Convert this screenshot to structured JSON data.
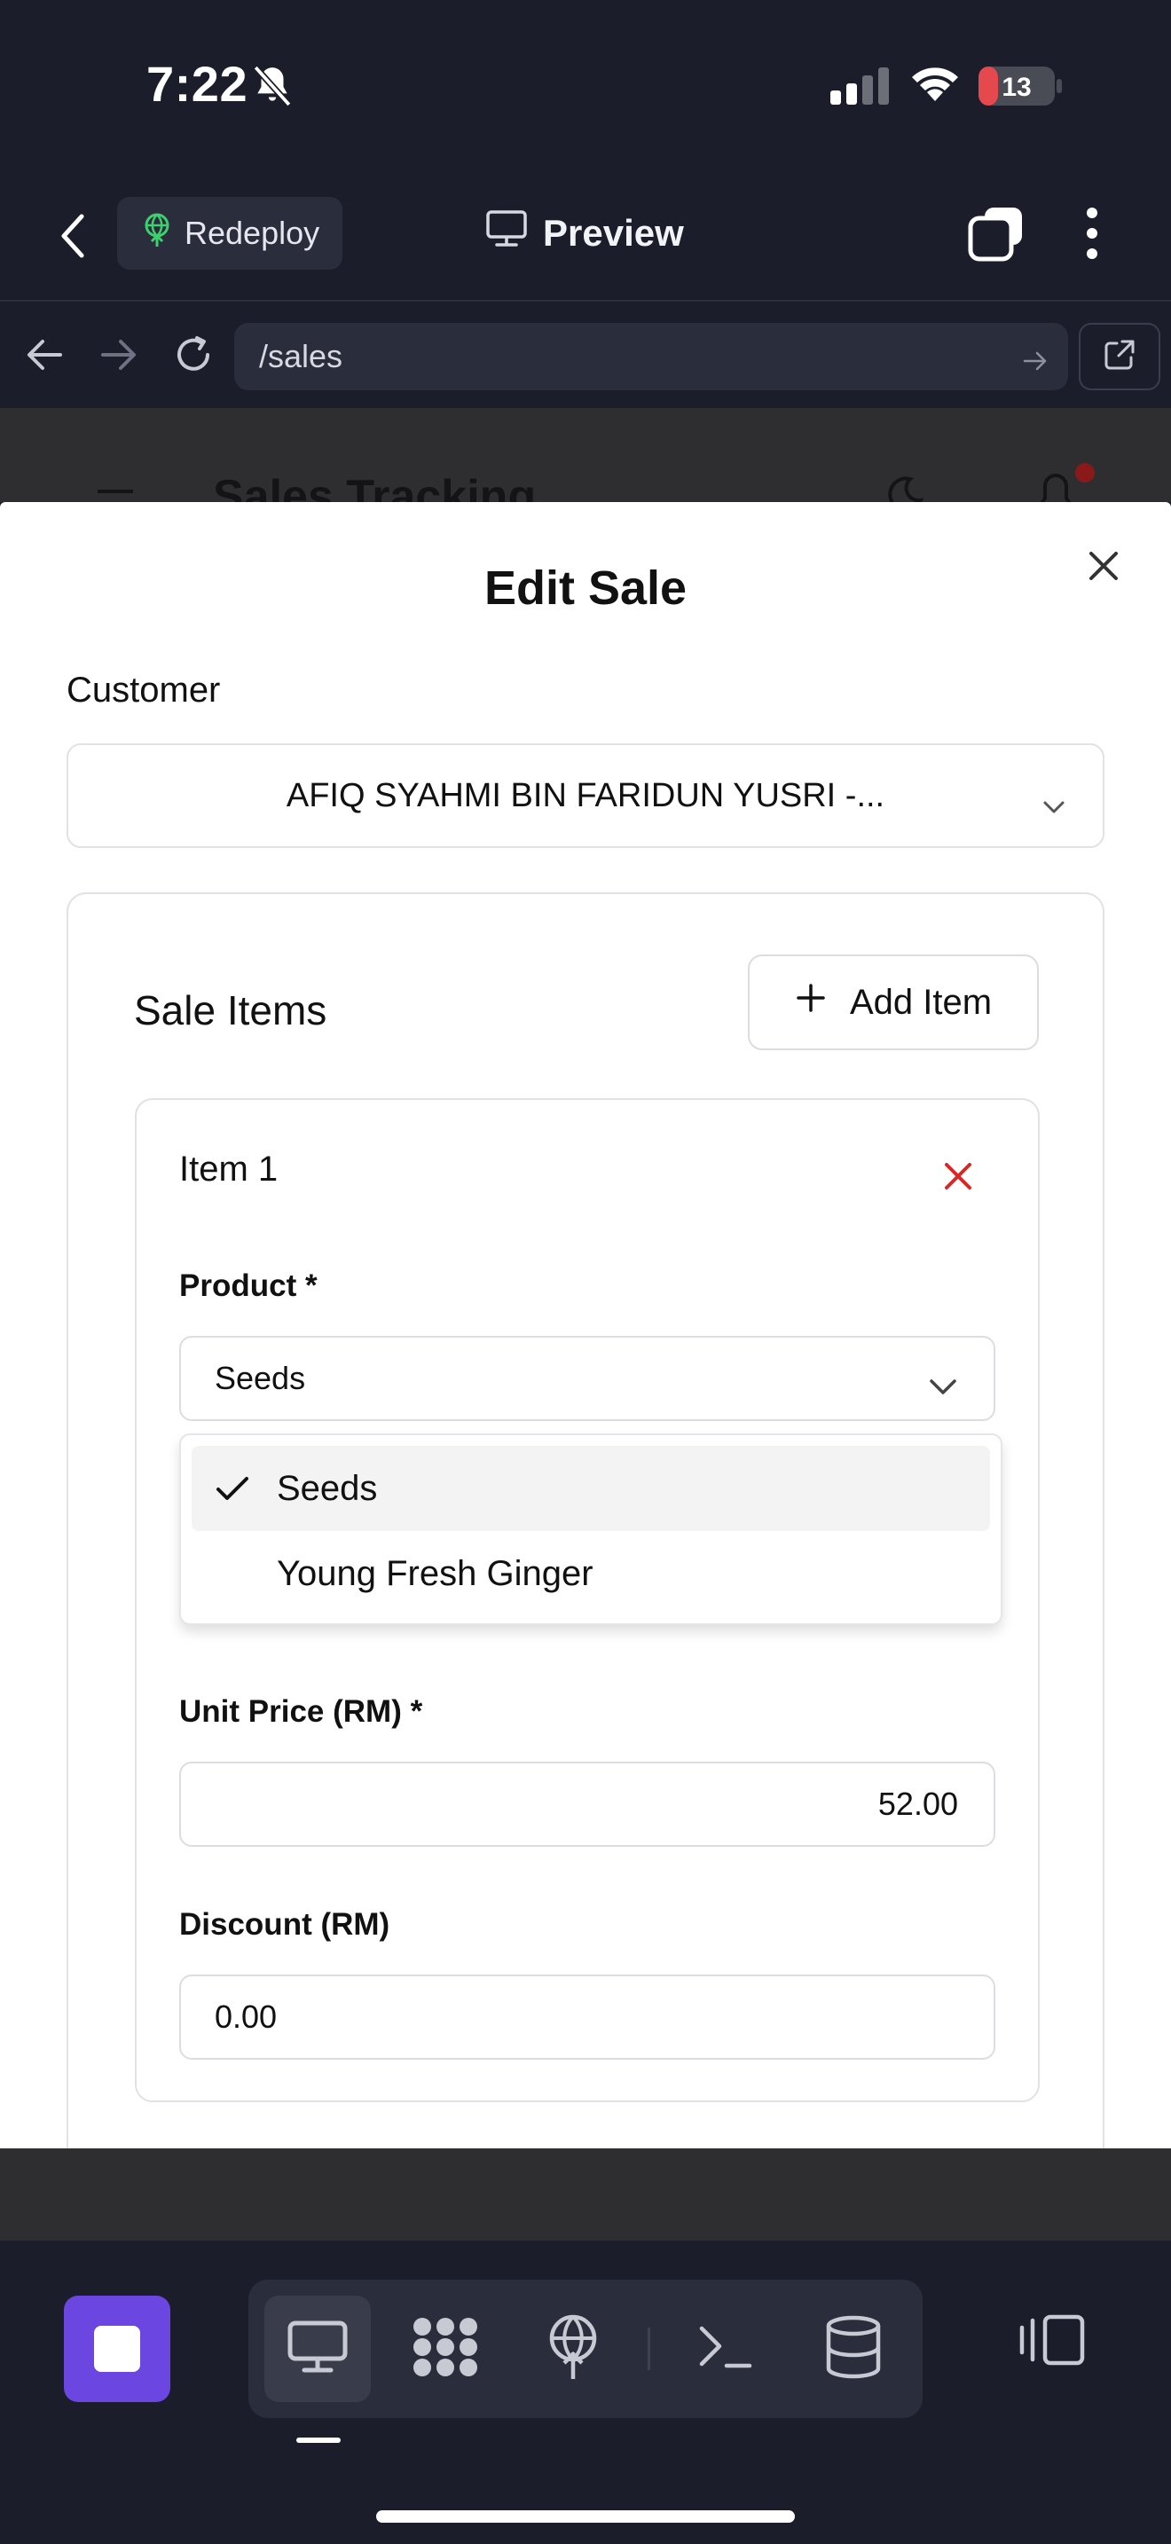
{
  "status_bar": {
    "time": "7:22",
    "battery_level": "13",
    "icons": [
      "bell-slash-icon",
      "cellular-signal-icon",
      "wifi-icon",
      "battery-icon"
    ]
  },
  "app_header": {
    "redeploy_label": "Redeploy",
    "preview_label": "Preview",
    "icons": [
      "chevron-left-icon",
      "globe-icon",
      "monitor-icon",
      "windows-icon",
      "more-vertical-icon"
    ]
  },
  "browser_bar": {
    "url": "/sales",
    "icons": [
      "arrow-left-icon",
      "arrow-right-icon",
      "reload-icon",
      "arrow-right-small-icon",
      "external-link-icon"
    ]
  },
  "background_page": {
    "title": "Sales Tracking"
  },
  "modal": {
    "title": "Edit Sale",
    "customer": {
      "label": "Customer",
      "value": "AFIQ SYAHMI BIN FARIDUN YUSRI -..."
    },
    "sale_items": {
      "title": "Sale Items",
      "add_item_label": "Add Item",
      "items": [
        {
          "title": "Item 1",
          "product_label": "Product *",
          "product_value": "Seeds",
          "product_options": [
            {
              "label": "Seeds",
              "selected": true
            },
            {
              "label": "Young Fresh Ginger",
              "selected": false
            }
          ],
          "unit_price_label": "Unit Price (RM) *",
          "unit_price_value": "52.00",
          "discount_label": "Discount (RM)",
          "discount_value": "0.00"
        }
      ]
    }
  },
  "bottom_toolbar": {
    "accent_color": "#6b46e0",
    "tools": [
      "monitor-icon",
      "apps-icon",
      "deploy-icon",
      "terminal-icon",
      "database-icon"
    ],
    "active_tool": "monitor-icon"
  },
  "colors": {
    "dark_background": "#1b1d2b",
    "remove_red": "#dc2626",
    "battery_red": "#e5484d"
  }
}
